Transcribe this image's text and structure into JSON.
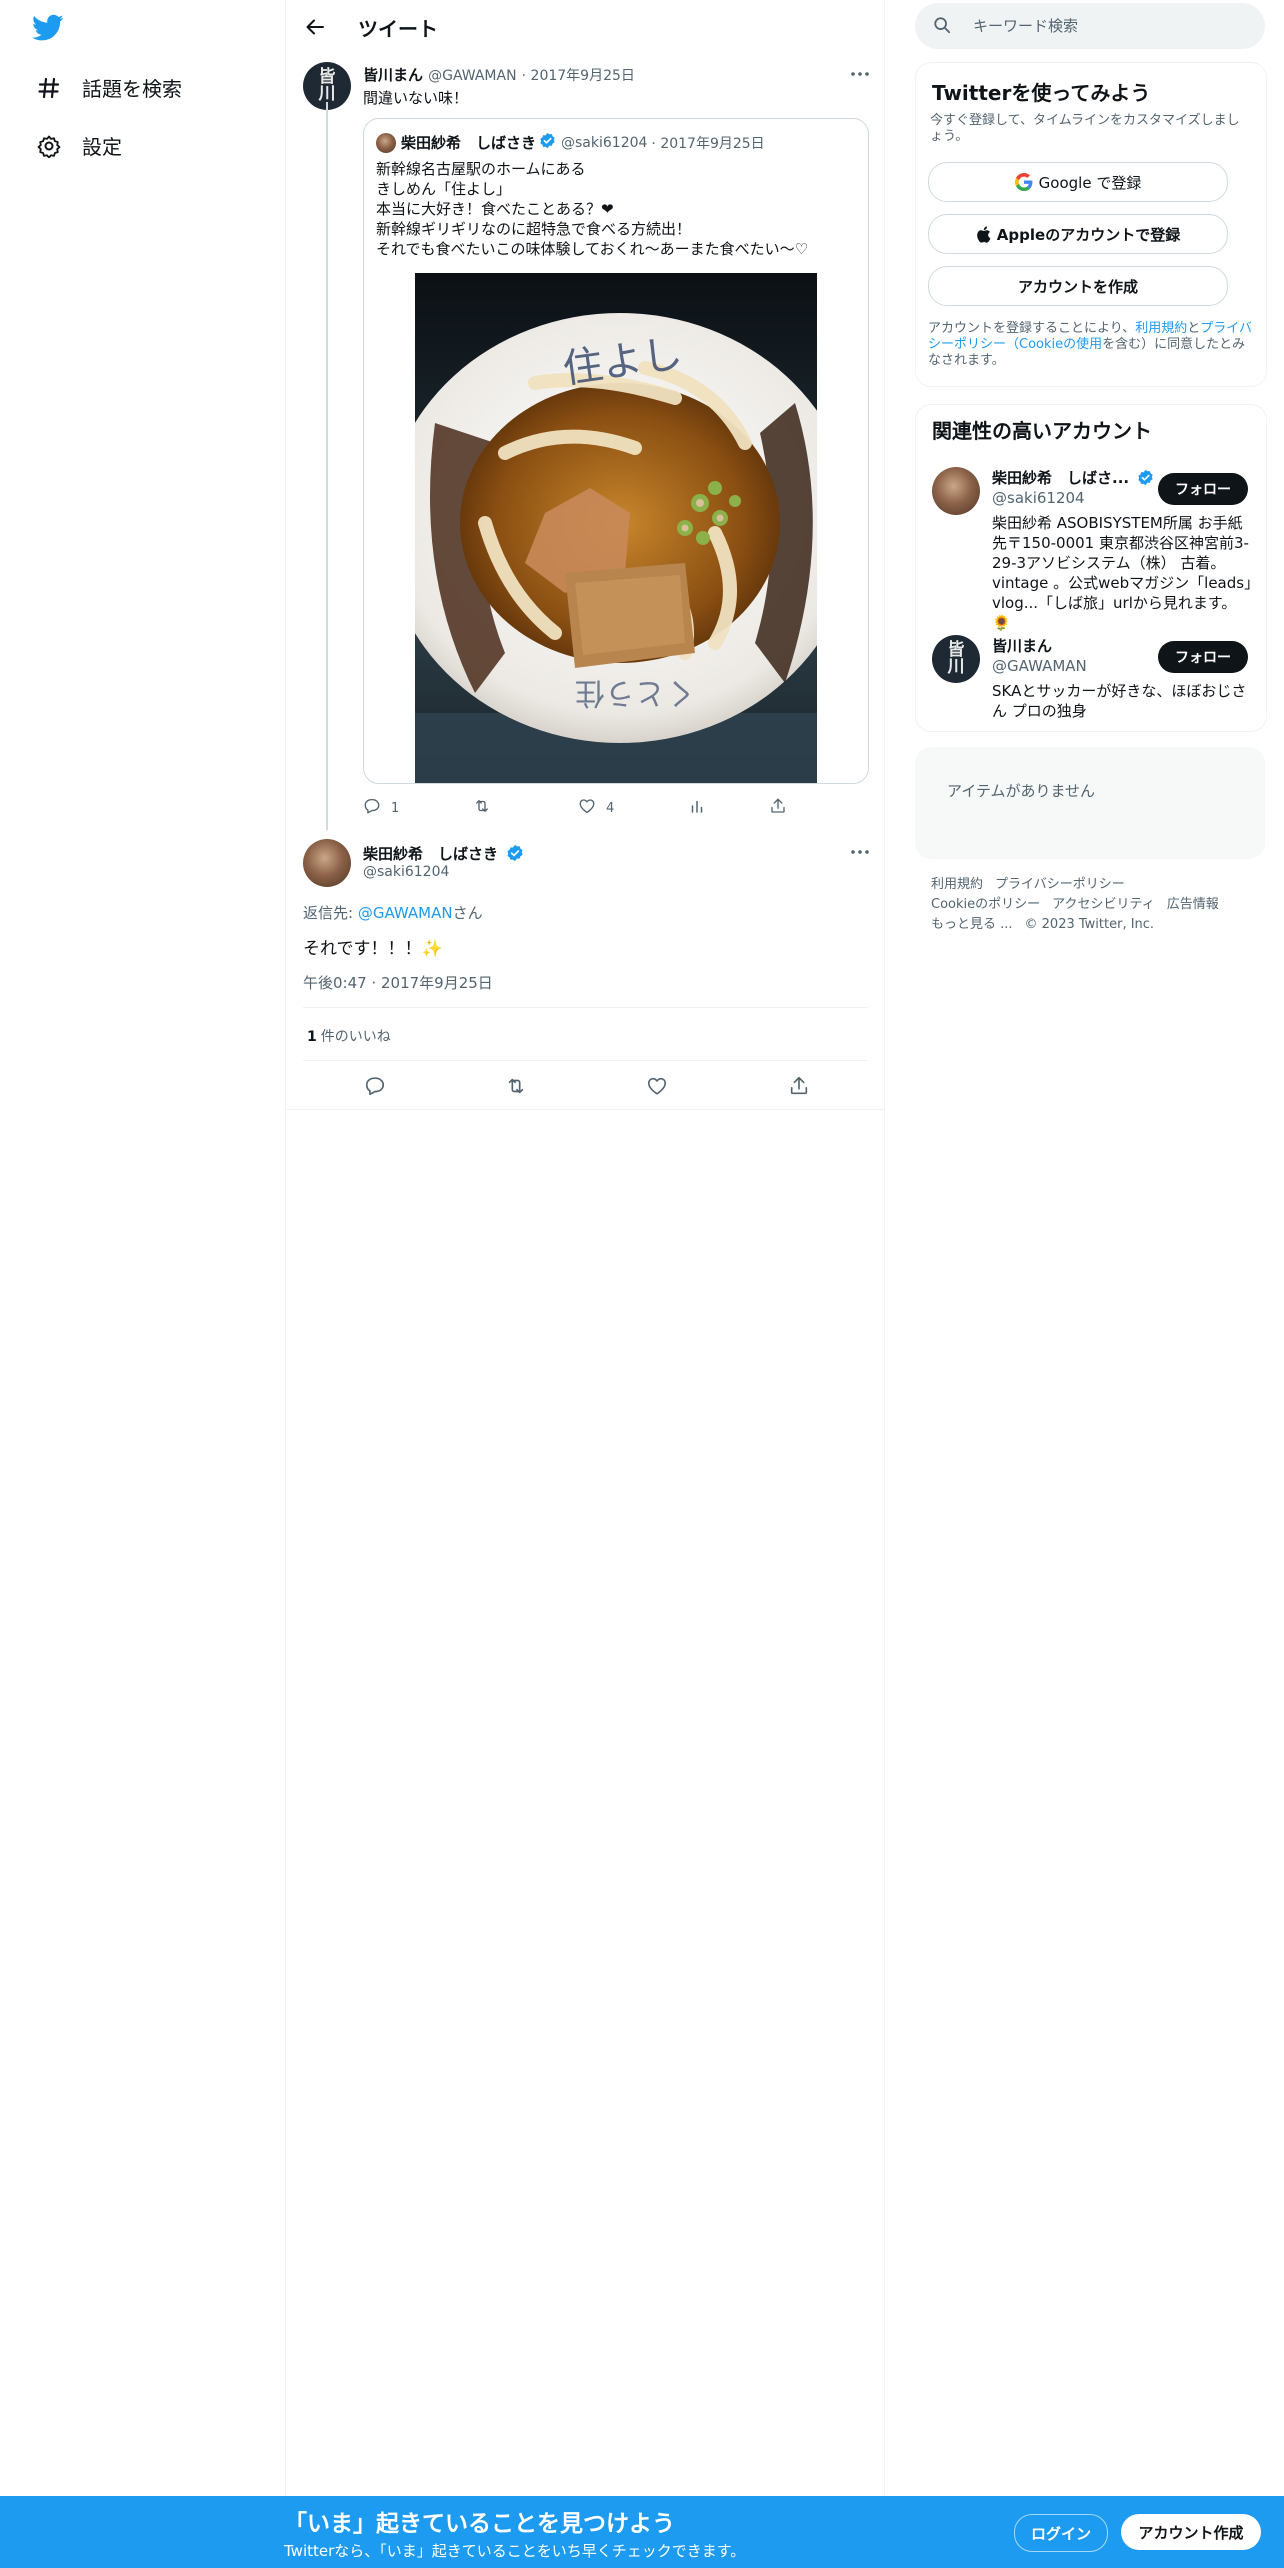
{
  "nav": {
    "logo_icon": "twitter-bird-icon",
    "items": [
      {
        "icon": "hashtag-icon",
        "label": "話題を検索"
      },
      {
        "icon": "gear-icon",
        "label": "設定"
      }
    ]
  },
  "header": {
    "title": "ツイート"
  },
  "parent_tweet": {
    "name": "皆川まん",
    "handle": "@GAWAMAN",
    "date": "· 2017年9月25日",
    "text": "間違いない味！",
    "avatar_text": [
      "皆",
      "川"
    ],
    "quote": {
      "name": "柴田紗希　しばさき",
      "handle": "@saki61204",
      "date": "· 2017年9月25日",
      "lines": [
        "新幹線名古屋駅のホームにある",
        "きしめん「住よし」",
        "本当に大好き！食べたことある？❤",
        "新幹線ギリギリなのに超特急で食べる方続出！",
        "それでも食べたいこの味体験しておくれ〜あーまた食べたい〜♡"
      ]
    },
    "actions": {
      "reply": "1",
      "retweet": "",
      "like": "4"
    }
  },
  "focus_tweet": {
    "name": "柴田紗希　しばさき",
    "handle": "@saki61204",
    "reply_prefix": "返信先: ",
    "reply_mention": "@GAWAMAN",
    "reply_suffix": "さん",
    "text": "それです！！！✨",
    "time": "午後0:47 · 2017年9月25日",
    "likes_count": "1",
    "likes_label": "件のいいね"
  },
  "search": {
    "placeholder": "キーワード検索"
  },
  "signup": {
    "title": "Twitterを使ってみよう",
    "subtitle": "今すぐ登録して、タイムラインをカスタマイズしましょう。",
    "google": "Google で登録",
    "apple": "Appleのアカウントで登録",
    "create": "アカウントを作成",
    "legal_1": "アカウントを登録することにより、",
    "legal_terms": "利用規約",
    "legal_2": "と",
    "legal_privacy": "プライバシーポリシー（Cookieの使用",
    "legal_3": "を含む）に同意したとみなされます。"
  },
  "related": {
    "title": "関連性の高いアカウント",
    "follow_label": "フォロー",
    "users": [
      {
        "name": "柴田紗希　しばさ...",
        "handle": "@saki61204",
        "bio": "柴田紗希 ASOBISYSTEM所属 お手紙先〒150-0001 東京都渋谷区神宮前3-29-3アソビシステム（株） 古着。vintage 。公式webマガジン「leads」vlog...「しば旅」urlから見れます。🌻"
      },
      {
        "name": "皆川まん",
        "handle": "@GAWAMAN",
        "bio": "SKAとサッカーが好きな、ほぼおじさん プロの独身"
      }
    ]
  },
  "trends": {
    "empty_text": "アイテムがありません"
  },
  "footer": {
    "links": [
      "利用規約",
      "プライバシーポリシー",
      "Cookieのポリシー",
      "アクセシビリティ",
      "広告情報",
      "もっと見る ..."
    ],
    "copyright": "© 2023 Twitter, Inc."
  },
  "bottom_bar": {
    "title": "「いま」起きていることを見つけよう",
    "subtitle": "Twitterなら、「いま」起きていることをいち早くチェックできます。",
    "login": "ログイン",
    "create": "アカウント作成"
  },
  "colors": {
    "accent": "#1d9bf0",
    "text": "#0f1419",
    "secondary": "#536471",
    "border": "#eff3f4",
    "like_heart": "#e0245e"
  }
}
